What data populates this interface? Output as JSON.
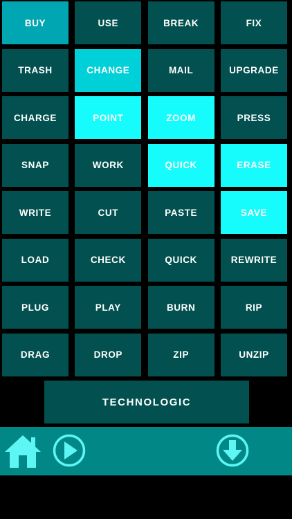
{
  "grid": {
    "buttons": [
      {
        "label": "BUY",
        "tone": "t1"
      },
      {
        "label": "USE",
        "tone": ""
      },
      {
        "label": "BREAK",
        "tone": ""
      },
      {
        "label": "FIX",
        "tone": ""
      },
      {
        "label": "TRASH",
        "tone": ""
      },
      {
        "label": "CHANGE",
        "tone": "t2"
      },
      {
        "label": "MAIL",
        "tone": ""
      },
      {
        "label": "UPGRADE",
        "tone": ""
      },
      {
        "label": "CHARGE",
        "tone": ""
      },
      {
        "label": "POINT",
        "tone": "t3"
      },
      {
        "label": "ZOOM",
        "tone": "t3"
      },
      {
        "label": "PRESS",
        "tone": ""
      },
      {
        "label": "SNAP",
        "tone": ""
      },
      {
        "label": "WORK",
        "tone": ""
      },
      {
        "label": "QUICK",
        "tone": "t3"
      },
      {
        "label": "ERASE",
        "tone": "t3"
      },
      {
        "label": "WRITE",
        "tone": ""
      },
      {
        "label": "CUT",
        "tone": ""
      },
      {
        "label": "PASTE",
        "tone": ""
      },
      {
        "label": "SAVE",
        "tone": "t3"
      },
      {
        "label": "LOAD",
        "tone": ""
      },
      {
        "label": "CHECK",
        "tone": ""
      },
      {
        "label": "QUICK",
        "tone": ""
      },
      {
        "label": "REWRITE",
        "tone": ""
      },
      {
        "label": "PLUG",
        "tone": ""
      },
      {
        "label": "PLAY",
        "tone": ""
      },
      {
        "label": "BURN",
        "tone": ""
      },
      {
        "label": "RIP",
        "tone": ""
      },
      {
        "label": "DRAG",
        "tone": ""
      },
      {
        "label": "DROP",
        "tone": ""
      },
      {
        "label": "ZIP",
        "tone": ""
      },
      {
        "label": "UNZIP",
        "tone": ""
      }
    ]
  },
  "footer_button": {
    "label": "TECHNOLOGIC"
  },
  "toolbar": {
    "icons": {
      "home": "home-icon",
      "play": "play-icon",
      "download": "arrow-down-icon"
    }
  },
  "colors": {
    "button_default": "#02504f",
    "button_tone_1": "#00a6b1",
    "button_tone_2": "#00d0d7",
    "button_tone_3": "#16fbfc",
    "toolbar": "#028787",
    "icon": "#5ef6f4"
  }
}
